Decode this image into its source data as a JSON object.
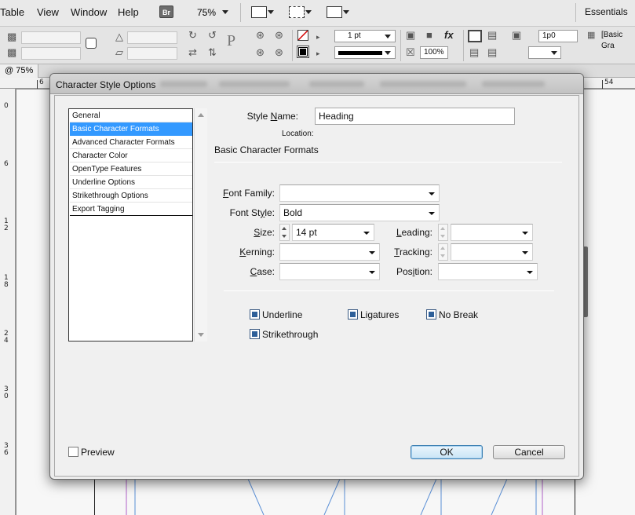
{
  "menubar": {
    "items": [
      "Table",
      "View",
      "Window",
      "Help"
    ],
    "bridge_badge": "Br",
    "zoom": "75%",
    "workspace": "Essentials"
  },
  "controlbar": {
    "stroke_weight": "1 pt",
    "opacity": "100%",
    "offset": "1p0",
    "object_style": "[Basic Gra"
  },
  "document_tab": {
    "label": "@ 75%"
  },
  "rulers": {
    "horizontal": [
      "6",
      "54"
    ],
    "vertical": [
      "0",
      "6",
      "1\n2",
      "1\n8",
      "2\n4",
      "3\n0",
      "3\n6"
    ]
  },
  "dialog": {
    "title": "Character Style Options",
    "categories": [
      {
        "label": "General",
        "selected": false
      },
      {
        "label": "Basic Character Formats",
        "selected": true
      },
      {
        "label": "Advanced Character Formats",
        "selected": false
      },
      {
        "label": "Character Color",
        "selected": false
      },
      {
        "label": "OpenType Features",
        "selected": false
      },
      {
        "label": "Underline Options",
        "selected": false
      },
      {
        "label": "Strikethrough Options",
        "selected": false
      },
      {
        "label": "Export Tagging",
        "selected": false
      }
    ],
    "style_name_label": "Style Name:",
    "style_name_value": "Heading",
    "location_label": "Location:",
    "section_title": "Basic Character Formats",
    "fields": {
      "font_family": {
        "label": "Font Family:",
        "value": ""
      },
      "font_style": {
        "label": "Font Style:",
        "value": "Bold"
      },
      "size": {
        "label": "Size:",
        "value": "14 pt"
      },
      "leading": {
        "label": "Leading:",
        "value": ""
      },
      "kerning": {
        "label": "Kerning:",
        "value": ""
      },
      "tracking": {
        "label": "Tracking:",
        "value": ""
      },
      "case": {
        "label": "Case:",
        "value": ""
      },
      "position": {
        "label": "Position:",
        "value": ""
      }
    },
    "checkboxes": {
      "underline": {
        "label": "Underline",
        "checked": true
      },
      "ligatures": {
        "label": "Ligatures",
        "checked": true
      },
      "no_break": {
        "label": "No Break",
        "checked": true
      },
      "strikethrough": {
        "label": "Strikethrough",
        "checked": true
      }
    },
    "preview": {
      "label": "Preview",
      "checked": false
    },
    "ok_label": "OK",
    "cancel_label": "Cancel"
  },
  "colors": {
    "selection": "#3399ff",
    "checkbox_fill": "#2d5f99",
    "default_button_border": "#3c7fb1",
    "guide_blue": "#5a8fd6",
    "guide_purple": "#b060c8"
  }
}
